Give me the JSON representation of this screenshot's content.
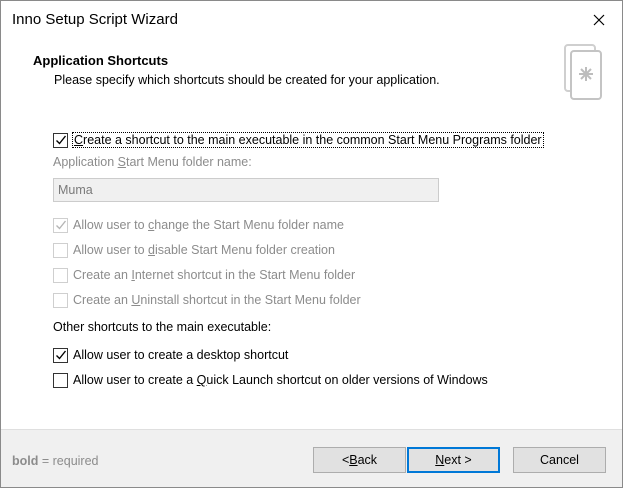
{
  "window": {
    "title": "Inno Setup Script Wizard"
  },
  "header": {
    "title": "Application Shortcuts",
    "subtitle": "Please specify which shortcuts should be created for your application."
  },
  "options": {
    "main_shortcut": {
      "pre": "",
      "key": "C",
      "post": "reate a shortcut to the main executable in the common Start Menu Programs folder",
      "checked": true,
      "enabled": true
    },
    "folder_label": {
      "pre": "Application ",
      "key": "S",
      "post": "tart Menu folder name:"
    },
    "folder_value": "Muma",
    "allow_change": {
      "pre": "Allow user to ",
      "key": "c",
      "post": "hange the Start Menu folder name",
      "checked": true,
      "enabled": false
    },
    "allow_disable": {
      "pre": "Allow user to ",
      "key": "d",
      "post": "isable Start Menu folder creation",
      "checked": false,
      "enabled": false
    },
    "internet_shortcut": {
      "pre": "Create an ",
      "key": "I",
      "post": "nternet shortcut in the Start Menu folder",
      "checked": false,
      "enabled": false
    },
    "uninstall_shortcut": {
      "pre": "Create an ",
      "key": "U",
      "post": "ninstall shortcut in the Start Menu folder",
      "checked": false,
      "enabled": false
    },
    "other_label": "Other shortcuts to the main executable:",
    "desktop_shortcut": {
      "pre": "Allow user to create a desktop shortcut",
      "key": "",
      "post": "",
      "checked": true,
      "enabled": true
    },
    "quicklaunch_shortcut": {
      "pre": "Allow user to create a ",
      "key": "Q",
      "post": "uick Launch shortcut on older versions of Windows",
      "checked": false,
      "enabled": true
    }
  },
  "footer": {
    "hint_bold": "bold",
    "hint_rest": " = required",
    "back": {
      "pre": "< ",
      "key": "B",
      "post": "ack"
    },
    "next": {
      "pre": "",
      "key": "N",
      "post": "ext >"
    },
    "cancel": "Cancel"
  },
  "icons": {
    "close": "close-icon",
    "wizard": "wizard-document-icon",
    "check": "checkmark-icon"
  },
  "colors": {
    "accent": "#0078d7",
    "footer_bg": "#f0f0f0",
    "disabled_text": "#8c8c8c"
  }
}
